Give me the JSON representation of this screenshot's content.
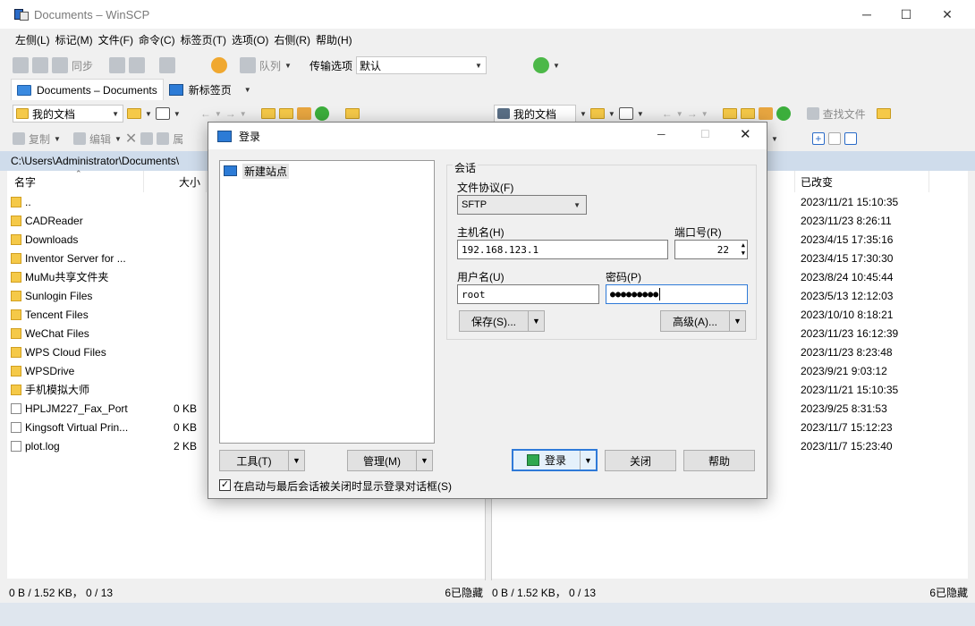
{
  "window": {
    "title": "Documents – WinSCP"
  },
  "menu": [
    "左侧(L)",
    "标记(M)",
    "文件(F)",
    "命令(C)",
    "标签页(T)",
    "选项(O)",
    "右侧(R)",
    "帮助(H)"
  ],
  "toolbar": {
    "sync": "同步",
    "queue": "队列",
    "transfer_options_label": "传输选项",
    "transfer_options_value": "默认"
  },
  "tabs": [
    {
      "label": "Documents – Documents"
    },
    {
      "label": "新标签页"
    }
  ],
  "left_pane": {
    "location": "我的文档",
    "path": "C:\\Users\\Administrator\\Documents\\",
    "columns": {
      "name": "名字",
      "size": "大小"
    },
    "actions": {
      "copy": "复制",
      "edit": "编辑",
      "properties": "属"
    },
    "rows": [
      {
        "name": "..",
        "size": "",
        "type": "up"
      },
      {
        "name": "CADReader",
        "size": "",
        "type": "folder"
      },
      {
        "name": "Downloads",
        "size": "",
        "type": "folder"
      },
      {
        "name": "Inventor Server for ...",
        "size": "",
        "type": "folder"
      },
      {
        "name": "MuMu共享文件夹",
        "size": "",
        "type": "folder"
      },
      {
        "name": "Sunlogin Files",
        "size": "",
        "type": "folder"
      },
      {
        "name": "Tencent Files",
        "size": "",
        "type": "folder"
      },
      {
        "name": "WeChat Files",
        "size": "",
        "type": "folder"
      },
      {
        "name": "WPS Cloud Files",
        "size": "",
        "type": "folder"
      },
      {
        "name": "WPSDrive",
        "size": "",
        "type": "folder"
      },
      {
        "name": "手机模拟大师",
        "size": "",
        "type": "folder"
      },
      {
        "name": "HPLJM227_Fax_Port",
        "size": "0 KB",
        "type": "file"
      },
      {
        "name": "Kingsoft Virtual Prin...",
        "size": "0 KB",
        "type": "file"
      },
      {
        "name": "plot.log",
        "size": "2 KB",
        "type": "file"
      }
    ],
    "status": "0 B / 1.52 KB， 0 / 13",
    "hidden": "6已隐藏"
  },
  "right_pane": {
    "location": "我的文档",
    "find_files": "查找文件",
    "columns": {
      "changed": "已改变"
    },
    "rows": [
      "2023/11/21 15:10:35",
      "2023/11/23 8:26:11",
      "2023/4/15 17:35:16",
      "2023/4/15 17:30:30",
      "2023/8/24 10:45:44",
      "2023/5/13 12:12:03",
      "2023/10/10 8:18:21",
      "2023/11/23 16:12:39",
      "2023/11/23 8:23:48",
      "2023/9/21 9:03:12",
      "2023/11/21 15:10:35",
      "2023/9/25 8:31:53",
      "2023/11/7 15:12:23",
      "2023/11/7 15:23:40"
    ],
    "status": "0 B / 1.52 KB， 0 / 13",
    "hidden": "6已隐藏"
  },
  "dialog": {
    "title": "登录",
    "site_tree": {
      "new_site": "新建站点"
    },
    "session_group": "会话",
    "protocol_label": "文件协议(F)",
    "protocol_value": "SFTP",
    "host_label": "主机名(H)",
    "host_value": "192.168.123.1",
    "port_label": "端口号(R)",
    "port_value": "22",
    "user_label": "用户名(U)",
    "user_value": "root",
    "password_label": "密码(P)",
    "password_value": "●●●●●●●●●",
    "save": "保存(S)...",
    "advanced": "高级(A)...",
    "tools": "工具(T)",
    "manage": "管理(M)",
    "login": "登录",
    "close": "关闭",
    "help": "帮助",
    "checkbox_label": "在启动与最后会话被关闭时显示登录对话框(S)",
    "checkbox_checked": "✓"
  }
}
